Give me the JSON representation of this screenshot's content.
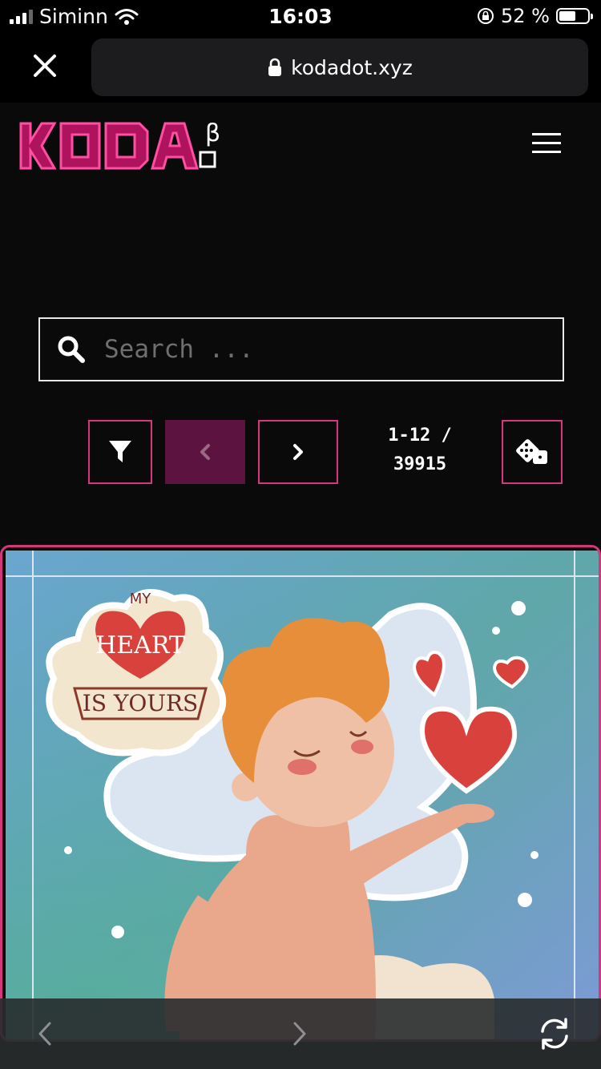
{
  "status_bar": {
    "carrier": "Siminn",
    "time": "16:03",
    "battery": "52 %",
    "battery_level": 0.52
  },
  "browser": {
    "url": "kodadot.xyz",
    "close_icon": "close-icon",
    "lock_icon": "lock-icon"
  },
  "site": {
    "logo_text": "KODA",
    "logo_badge": "β",
    "menu_icon": "hamburger-icon"
  },
  "search": {
    "placeholder": "Search ...",
    "value": ""
  },
  "pagination": {
    "range": "1-12 /",
    "total": "39915",
    "filter_icon": "filter-icon",
    "prev_icon": "chevron-left-icon",
    "next_icon": "chevron-right-icon",
    "random_icon": "dice-icon"
  },
  "card": {
    "sticker_line1": "MY",
    "sticker_line2": "HEART",
    "sticker_line3": "IS YOURS"
  },
  "toolbar": {
    "back_icon": "chevron-left-icon",
    "forward_icon": "chevron-right-icon",
    "reload_icon": "reload-icon"
  },
  "colors": {
    "accent": "#d5367c",
    "background": "#0b0a0b",
    "prev_disabled": "#5c1340"
  }
}
